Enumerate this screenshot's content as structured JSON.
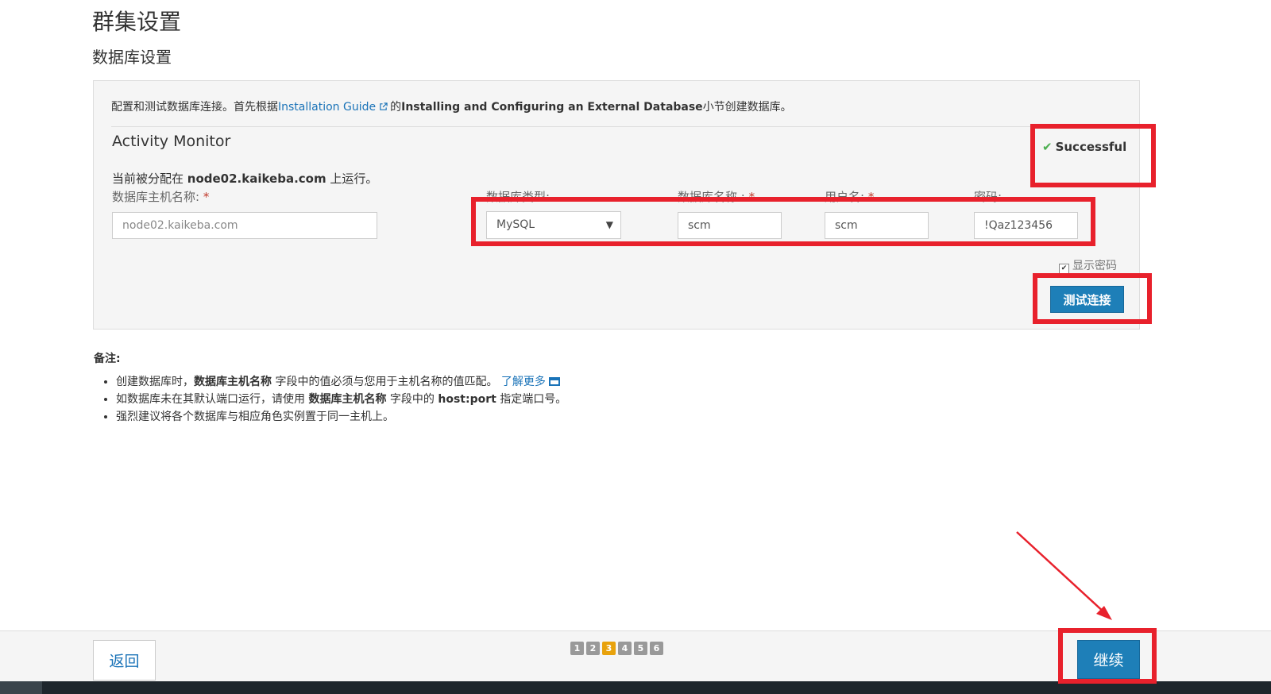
{
  "page": {
    "title": "群集设置",
    "section": "数据库设置"
  },
  "panel": {
    "intro_prefix": "配置和测试数据库连接。首先根据",
    "intro_link": "Installation Guide",
    "intro_mid": "的",
    "intro_bold": "Installing and Configuring an External Database",
    "intro_suffix": "小节创建数据库。",
    "service_name": "Activity Monitor",
    "status": "Successful",
    "assigned_prefix": "当前被分配在 ",
    "assigned_host": "node02.kaikeba.com",
    "assigned_suffix": " 上运行。",
    "fields": {
      "host_label": "数据库主机名称:",
      "host_placeholder": "node02.kaikeba.com",
      "type_label": "数据库类型:",
      "type_value": "MySQL",
      "dbname_label": "数据库名称 :",
      "dbname_value": "scm",
      "user_label": "用户名:",
      "user_value": "scm",
      "password_label": "密码:",
      "password_value": "!Qaz123456",
      "required_mark": "*"
    },
    "show_password_label": "显示密码",
    "test_button": "测试连接"
  },
  "notes": {
    "title": "备注:",
    "item1_prefix": "创建数据库时，",
    "item1_bold": "数据库主机名称",
    "item1_mid": " 字段中的值必须与您用于主机名称的值匹配。 ",
    "item1_link": "了解更多",
    "item2_prefix": "如数据库未在其默认端口运行，请使用 ",
    "item2_bold": "数据库主机名称",
    "item2_mid": " 字段中的 ",
    "item2_bold2": "host:port",
    "item2_suffix": " 指定端口号。",
    "item3": "强烈建议将各个数据库与相应角色实例置于同一主机上。"
  },
  "footer": {
    "back_button": "返回",
    "continue_button": "继续",
    "steps": [
      "1",
      "2",
      "3",
      "4",
      "5",
      "6"
    ],
    "active_step": "3"
  },
  "colors": {
    "accent": "#1e7fb8",
    "annotation": "#e8212c",
    "success": "#4caf50",
    "active_step": "#e8a20c"
  }
}
